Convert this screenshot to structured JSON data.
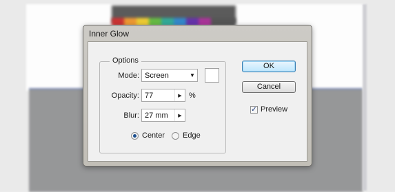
{
  "dialog": {
    "title": "Inner Glow",
    "options": {
      "legend": "Options",
      "mode": {
        "label": "Mode:",
        "value": "Screen",
        "color": "#ffffff"
      },
      "opacity": {
        "label": "Opacity:",
        "value": "77",
        "unit": "%"
      },
      "blur": {
        "label": "Blur:",
        "value": "27 mm"
      },
      "source": [
        {
          "label": "Center",
          "selected": true
        },
        {
          "label": "Edge",
          "selected": false
        }
      ]
    },
    "buttons": {
      "ok": "OK",
      "cancel": "Cancel"
    },
    "preview": {
      "label": "Preview",
      "checked": true
    }
  },
  "icons": {
    "dropdown": "chevron-down-icon",
    "spinner": "chevron-right-icon",
    "checkmark": "check-icon",
    "radio": "radio-dot-icon"
  },
  "colors": {
    "default_button_border": "#3c7fb1",
    "glow_color": "#ffffff"
  }
}
